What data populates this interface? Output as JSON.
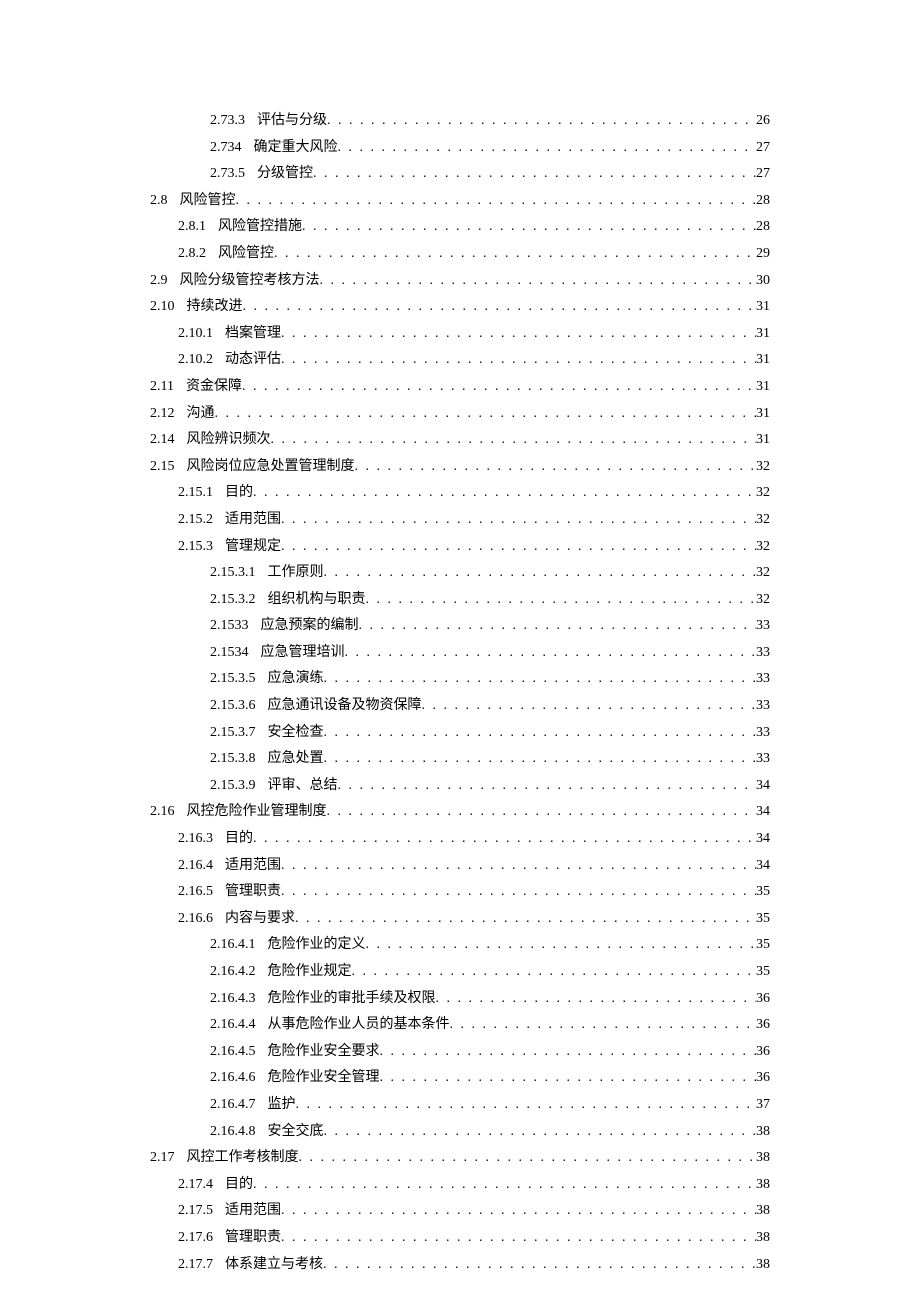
{
  "toc": [
    {
      "level": 2,
      "num": "2.73.3",
      "title": "评估与分级",
      "page": "26"
    },
    {
      "level": 2,
      "num": "2.734",
      "title": "确定重大风险",
      "page": "27"
    },
    {
      "level": 2,
      "num": "2.73.5",
      "title": "分级管控",
      "page": "27"
    },
    {
      "level": 0,
      "num": "2.8",
      "title": "风险管控",
      "page": "28"
    },
    {
      "level": 1,
      "num": "2.8.1",
      "title": "风险管控措施",
      "page": "28"
    },
    {
      "level": 1,
      "num": "2.8.2",
      "title": "风险管控",
      "page": "29"
    },
    {
      "level": 0,
      "num": "2.9",
      "title": "风险分级管控考核方法",
      "page": "30"
    },
    {
      "level": 0,
      "num": "2.10",
      "title": "持续改进",
      "page": "31"
    },
    {
      "level": 1,
      "num": "2.10.1",
      "title": "档案管理",
      "page": "31"
    },
    {
      "level": 1,
      "num": "2.10.2",
      "title": "动态评估",
      "page": "31"
    },
    {
      "level": 0,
      "num": "2.11",
      "title": "资金保障",
      "page": "31"
    },
    {
      "level": 0,
      "num": "2.12",
      "title": "沟通",
      "page": "31"
    },
    {
      "level": 0,
      "num": "2.14",
      "title": "风险辨识频次",
      "page": "31"
    },
    {
      "level": 0,
      "num": "2.15",
      "title": "风险岗位应急处置管理制度",
      "page": "32"
    },
    {
      "level": 1,
      "num": "2.15.1",
      "title": "目的",
      "page": "32"
    },
    {
      "level": 1,
      "num": "2.15.2",
      "title": "适用范围",
      "page": "32"
    },
    {
      "level": 1,
      "num": "2.15.3",
      "title": "管理规定",
      "page": "32"
    },
    {
      "level": 2,
      "num": "2.15.3.1",
      "title": "工作原则",
      "page": "32"
    },
    {
      "level": 2,
      "num": "2.15.3.2",
      "title": "组织机构与职责",
      "page": "32"
    },
    {
      "level": 2,
      "num": "2.1533",
      "title": "应急预案的编制",
      "page": "33"
    },
    {
      "level": 2,
      "num": "2.1534",
      "title": "应急管理培训",
      "page": "33"
    },
    {
      "level": 2,
      "num": "2.15.3.5",
      "title": "应急演练",
      "page": "33"
    },
    {
      "level": 2,
      "num": "2.15.3.6",
      "title": "应急通讯设备及物资保障",
      "page": "33"
    },
    {
      "level": 2,
      "num": "2.15.3.7",
      "title": "安全检查",
      "page": "33"
    },
    {
      "level": 2,
      "num": "2.15.3.8",
      "title": "应急处置",
      "page": "33"
    },
    {
      "level": 2,
      "num": "2.15.3.9",
      "title": "评审、总结",
      "page": "34"
    },
    {
      "level": 0,
      "num": "2.16",
      "title": "风控危险作业管理制度",
      "page": "34"
    },
    {
      "level": 1,
      "num": "2.16.3",
      "title": "目的",
      "page": "34"
    },
    {
      "level": 1,
      "num": "2.16.4",
      "title": "适用范围",
      "page": "34"
    },
    {
      "level": 1,
      "num": "2.16.5",
      "title": "管理职责",
      "page": "35"
    },
    {
      "level": 1,
      "num": "2.16.6",
      "title": "内容与要求",
      "page": "35"
    },
    {
      "level": 2,
      "num": "2.16.4.1",
      "title": "危险作业的定义",
      "page": "35"
    },
    {
      "level": 2,
      "num": "2.16.4.2",
      "title": "危险作业规定",
      "page": "35"
    },
    {
      "level": 2,
      "num": "2.16.4.3",
      "title": "危险作业的审批手续及权限",
      "page": "36"
    },
    {
      "level": 2,
      "num": "2.16.4.4",
      "title": "从事危险作业人员的基本条件",
      "page": "36"
    },
    {
      "level": 2,
      "num": "2.16.4.5",
      "title": "危险作业安全要求",
      "page": "36"
    },
    {
      "level": 2,
      "num": "2.16.4.6",
      "title": "危险作业安全管理",
      "page": "36"
    },
    {
      "level": 2,
      "num": "2.16.4.7",
      "title": "监护",
      "page": "37"
    },
    {
      "level": 2,
      "num": "2.16.4.8",
      "title": "安全交底",
      "page": "38"
    },
    {
      "level": 0,
      "num": "2.17",
      "title": "风控工作考核制度",
      "page": "38"
    },
    {
      "level": 1,
      "num": "2.17.4",
      "title": "目的",
      "page": "38"
    },
    {
      "level": 1,
      "num": "2.17.5",
      "title": "适用范围",
      "page": "38"
    },
    {
      "level": 1,
      "num": "2.17.6",
      "title": "管理职责",
      "page": "38"
    },
    {
      "level": 1,
      "num": "2.17.7",
      "title": "体系建立与考核",
      "page": "38"
    }
  ]
}
